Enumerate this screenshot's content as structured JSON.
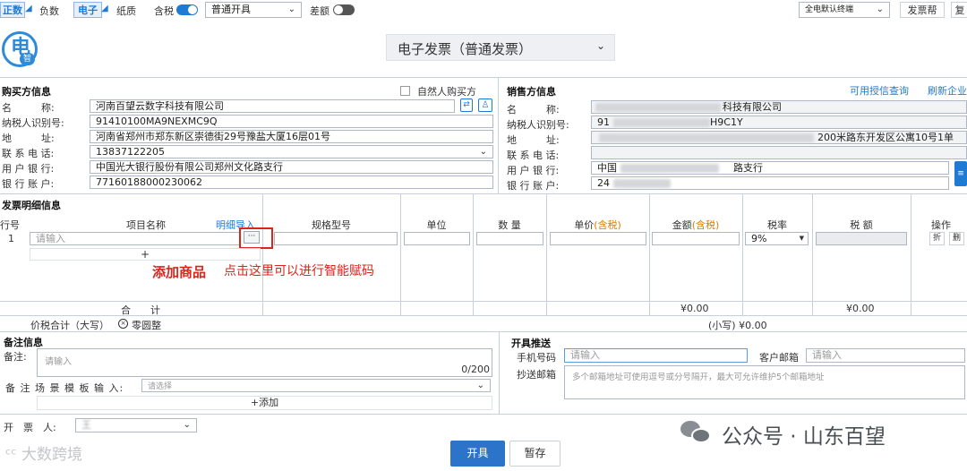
{
  "toolbar": {
    "normal": "正数",
    "negative": "负数",
    "electronic": "电子",
    "paper": "纸质",
    "tax_included": "含税",
    "issue_mode": "普通开具",
    "difference": "差额",
    "terminal": "全电默认终端",
    "help": "发票帮",
    "copy": "复"
  },
  "logo": {
    "text": "电",
    "sub": "智"
  },
  "invoice_type": "电子发票（普通发票）",
  "buyer": {
    "section": "购买方信息",
    "natural_person": "自然人购买方",
    "name_label": "名　　　称:",
    "name": "河南百望云数字科技有限公司",
    "tax_id_label": "纳税人识别号:",
    "tax_id": "91410100MA9NEXMC9Q",
    "address_label": "地　　　址:",
    "address": "河南省郑州市郑东新区崇德街29号豫盐大厦16层01号",
    "phone_label": "联 系 电 话:",
    "phone": "13837122205",
    "bank_label": "用 户 银 行:",
    "bank": "中国光大银行股份有限公司郑州文化路支行",
    "account_label": "银 行 账 户:",
    "account": "77160188000230062"
  },
  "seller": {
    "section": "销售方信息",
    "credit_query": "可用授信查询",
    "refresh": "刷新企业",
    "name_label": "名　　　称:",
    "name": "科技有限公司",
    "tax_id_label": "纳税人识别号:",
    "tax_id_prefix": "91",
    "tax_id_suffix": "H9C1Y",
    "address_label": "地　　　址:",
    "address": "200米路东开发区公寓10号1单",
    "phone_label": "联 系 电 话:",
    "bank_label": "用 户 银 行:",
    "bank_prefix": "中国",
    "bank_suffix": "路支行",
    "account_label": "银 行 账 户:",
    "account_prefix": "24"
  },
  "details": {
    "section": "发票明细信息",
    "columns": {
      "row_no": "行号",
      "item_name": "项目名称",
      "detail_import": "明细导入",
      "spec": "规格型号",
      "unit": "单位",
      "qty": "数 量",
      "price": "单价",
      "price_tag": "(含税)",
      "amount": "金额",
      "amount_tag": "(含税)",
      "rate": "税率",
      "tax": "税 额",
      "ops": "操作"
    },
    "row": {
      "no": "1",
      "placeholder": "请输入",
      "rate": "9%",
      "op1": "折",
      "op2": "删"
    },
    "add": "+",
    "annotation_a": "添加商品",
    "annotation_b": "点击这里可以进行智能赋码",
    "total_label": "合　　计",
    "total_amount": "¥0.00",
    "total_tax": "¥0.00",
    "grand_label": "价税合计（大写）",
    "grand_upper": "零圆整",
    "grand_lower": "(小写) ¥0.00"
  },
  "remarks": {
    "section": "备注信息",
    "label": "备注:",
    "placeholder": "请输入",
    "counter": "0/200",
    "template_label": "备 注 场 景 模 板 输 入:",
    "template_placeholder": "请选择",
    "add": "+添加"
  },
  "push": {
    "section": "开具推送",
    "phone_label": "手机号码",
    "phone_placeholder": "请输入",
    "email_label": "客户邮箱",
    "email_placeholder": "请输入",
    "cc_label": "抄送邮箱",
    "cc_placeholder": "多个邮箱地址可使用逗号或分号隔开，最大可允许维护5个邮箱地址"
  },
  "issuer": {
    "label": "开　票　人:",
    "value": "王"
  },
  "actions": {
    "issue": "开具",
    "save": "暂存"
  },
  "watermark_left": "大数跨境",
  "watermark_right": "公众号 · 山东百望",
  "colors": {
    "accent": "#1f7ad4",
    "primary_btn": "#2b74c9",
    "red": "#d9251d"
  }
}
